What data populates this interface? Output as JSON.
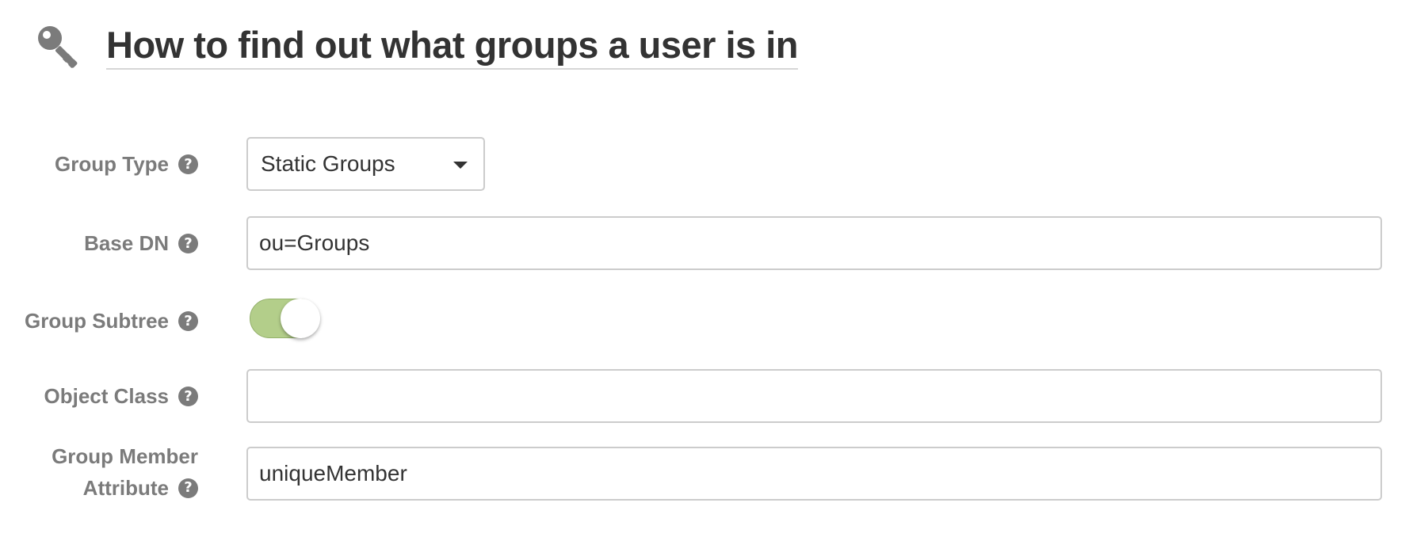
{
  "header": {
    "icon": "key-icon",
    "title": "How to find out what groups a user is in"
  },
  "form": {
    "group_type": {
      "label": "Group Type",
      "selected": "Static Groups"
    },
    "base_dn": {
      "label": "Base DN",
      "value": "ou=Groups"
    },
    "group_subtree": {
      "label": "Group Subtree",
      "enabled": true
    },
    "object_class": {
      "label": "Object Class",
      "value": ""
    },
    "group_member_attribute": {
      "label_line1": "Group Member",
      "label_line2": "Attribute",
      "value": "uniqueMember"
    },
    "help_icon_glyph": "?"
  },
  "colors": {
    "label": "#7b7b7b",
    "toggle_on": "#b3ce8a",
    "border": "#cccccc",
    "title": "#333333"
  }
}
